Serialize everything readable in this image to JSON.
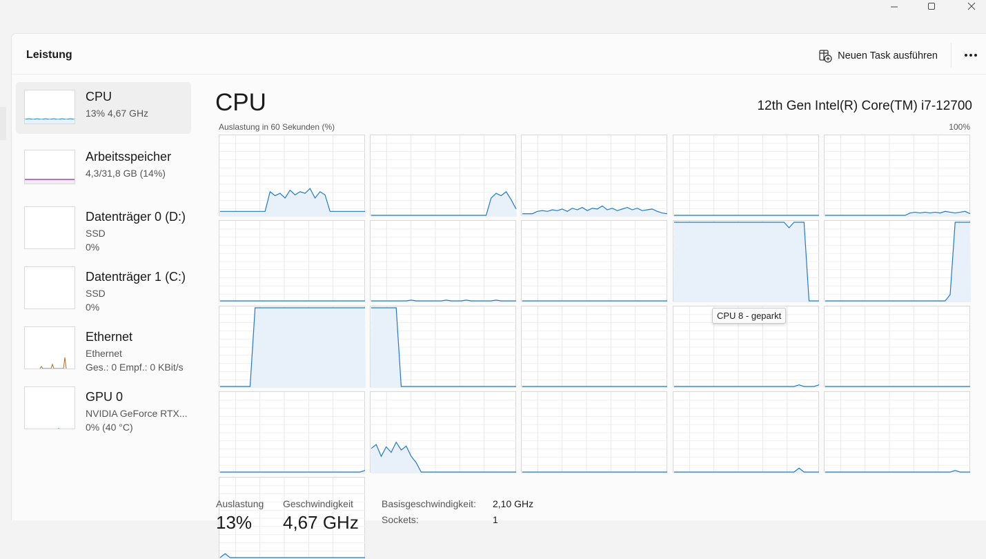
{
  "window": {
    "controls": [
      "minimize-icon",
      "maximize-icon",
      "close-icon"
    ]
  },
  "header": {
    "title": "Leistung",
    "run_task_label": "Neuen Task ausführen",
    "more_icon": "more-icon"
  },
  "sidebar": {
    "items": [
      {
        "name": "CPU",
        "sub1": "13%  4,67 GHz",
        "sub2": "",
        "color": "#1f78c8"
      },
      {
        "name": "Arbeitsspeicher",
        "sub1": "4,3/31,8 GB (14%)",
        "sub2": "",
        "color": "#8b2a9b"
      },
      {
        "name": "Datenträger 0 (D:)",
        "sub1": "SSD",
        "sub2": "0%",
        "color": "#4c9a2a"
      },
      {
        "name": "Datenträger 1 (C:)",
        "sub1": "SSD",
        "sub2": "0%",
        "color": "#4c9a2a"
      },
      {
        "name": "Ethernet",
        "sub1": "Ethernet",
        "sub2": "Ges.: 0  Empf.: 0 KBit/s",
        "color": "#b5651d"
      },
      {
        "name": "GPU 0",
        "sub1": "NVIDIA GeForce RTX...",
        "sub2": "0%  (40 °C)",
        "color": "#1f78c8"
      }
    ]
  },
  "main": {
    "title": "CPU",
    "model": "12th Gen Intel(R) Core(TM) i7-12700",
    "axis_label": "Auslastung in 60 Sekunden (%)",
    "axis_max": "100%",
    "tooltip": "CPU 8 - geparkt"
  },
  "stats": {
    "utilization_label": "Auslastung",
    "utilization_value": "13%",
    "speed_label": "Geschwindigkeit",
    "speed_value": "4,67 GHz",
    "base_speed_label": "Basisgeschwindigkeit:",
    "base_speed_value": "2,10 GHz",
    "sockets_label": "Sockets:",
    "sockets_value": "1"
  },
  "chart_data": {
    "type": "line",
    "title": "Auslastung in 60 Sekunden (%)",
    "ylim": [
      0,
      100
    ],
    "x_points": 30,
    "series": [
      {
        "values": [
          5,
          5,
          5,
          5,
          5,
          5,
          5,
          5,
          5,
          5,
          30,
          25,
          28,
          22,
          32,
          26,
          30,
          28,
          34,
          22,
          30,
          26,
          5,
          5,
          5,
          5,
          5,
          5,
          5,
          5
        ]
      },
      {
        "values": [
          0,
          0,
          0,
          0,
          0,
          0,
          0,
          0,
          0,
          0,
          0,
          0,
          0,
          0,
          0,
          0,
          0,
          0,
          0,
          0,
          0,
          0,
          0,
          0,
          22,
          28,
          25,
          30,
          20,
          8
        ]
      },
      {
        "values": [
          2,
          2,
          2,
          5,
          6,
          5,
          7,
          6,
          8,
          5,
          9,
          7,
          10,
          6,
          9,
          8,
          12,
          7,
          9,
          6,
          8,
          10,
          7,
          9,
          6,
          7,
          8,
          5,
          3,
          2
        ]
      },
      {
        "values": [
          0,
          0,
          0,
          0,
          0,
          0,
          0,
          0,
          0,
          0,
          0,
          0,
          0,
          0,
          0,
          0,
          0,
          0,
          0,
          0,
          0,
          0,
          0,
          0,
          0,
          0,
          0,
          0,
          0,
          0
        ]
      },
      {
        "values": [
          0,
          0,
          0,
          0,
          0,
          0,
          0,
          0,
          0,
          0,
          0,
          0,
          0,
          0,
          0,
          0,
          0,
          3,
          4,
          3,
          4,
          3,
          4,
          3,
          5,
          4,
          3,
          4,
          5,
          2
        ]
      },
      {
        "values": [
          0,
          0,
          0,
          0,
          0,
          0,
          0,
          0,
          0,
          0,
          0,
          0,
          0,
          0,
          0,
          0,
          0,
          0,
          0,
          0,
          0,
          0,
          0,
          0,
          0,
          0,
          0,
          0,
          0,
          0
        ]
      },
      {
        "values": [
          0,
          0,
          0,
          0,
          0,
          0,
          0,
          0,
          1,
          0,
          0,
          0,
          0,
          0,
          0,
          1,
          0,
          0,
          0,
          1,
          0,
          0,
          0,
          0,
          0,
          1,
          0,
          0,
          0,
          0
        ]
      },
      {
        "values": [
          0,
          0,
          0,
          0,
          0,
          0,
          0,
          0,
          0,
          0,
          0,
          0,
          0,
          0,
          0,
          0,
          0,
          0,
          0,
          0,
          0,
          0,
          0,
          0,
          0,
          0,
          0,
          0,
          0,
          0
        ]
      },
      {
        "values": [
          100,
          100,
          100,
          100,
          100,
          100,
          100,
          100,
          100,
          100,
          100,
          100,
          100,
          100,
          100,
          100,
          100,
          100,
          100,
          100,
          100,
          100,
          100,
          93,
          100,
          100,
          100,
          0,
          0,
          0
        ]
      },
      {
        "values": [
          0,
          0,
          0,
          0,
          0,
          0,
          0,
          0,
          0,
          0,
          0,
          0,
          0,
          0,
          0,
          0,
          0,
          0,
          0,
          0,
          0,
          0,
          0,
          0,
          0,
          8,
          100,
          100,
          100,
          100
        ]
      },
      {
        "values": [
          0,
          0,
          0,
          0,
          0,
          0,
          0,
          100,
          100,
          100,
          100,
          100,
          100,
          100,
          100,
          100,
          100,
          100,
          100,
          100,
          100,
          100,
          100,
          100,
          100,
          100,
          100,
          100,
          100,
          100
        ]
      },
      {
        "values": [
          100,
          100,
          100,
          100,
          100,
          100,
          0,
          0,
          0,
          0,
          0,
          0,
          0,
          0,
          0,
          0,
          0,
          0,
          0,
          0,
          0,
          0,
          0,
          0,
          0,
          0,
          0,
          0,
          0,
          0
        ]
      },
      {
        "values": [
          0,
          0,
          0,
          0,
          0,
          0,
          0,
          0,
          0,
          0,
          0,
          0,
          0,
          0,
          0,
          0,
          0,
          0,
          0,
          0,
          0,
          0,
          0,
          0,
          0,
          0,
          0,
          0,
          0,
          0
        ]
      },
      {
        "values": [
          0,
          0,
          0,
          0,
          0,
          0,
          0,
          0,
          0,
          0,
          0,
          0,
          0,
          0,
          0,
          0,
          0,
          0,
          0,
          0,
          0,
          0,
          0,
          0,
          0,
          2,
          0,
          0,
          0,
          2
        ]
      },
      {
        "values": [
          0,
          0,
          0,
          0,
          0,
          0,
          0,
          0,
          0,
          0,
          0,
          0,
          0,
          0,
          0,
          0,
          0,
          0,
          0,
          0,
          0,
          0,
          0,
          0,
          0,
          0,
          0,
          0,
          0,
          0
        ]
      },
      {
        "values": [
          0,
          0,
          0,
          0,
          0,
          0,
          0,
          0,
          0,
          0,
          0,
          0,
          0,
          0,
          0,
          0,
          0,
          0,
          0,
          0,
          0,
          0,
          0,
          0,
          0,
          0,
          0,
          0,
          0,
          2
        ]
      },
      {
        "values": [
          30,
          35,
          20,
          32,
          25,
          38,
          28,
          33,
          20,
          12,
          0,
          0,
          0,
          0,
          0,
          0,
          0,
          0,
          0,
          0,
          0,
          0,
          0,
          0,
          0,
          0,
          0,
          0,
          0,
          0
        ]
      },
      {
        "values": [
          0,
          0,
          0,
          0,
          0,
          0,
          0,
          0,
          0,
          0,
          0,
          0,
          0,
          0,
          0,
          0,
          0,
          0,
          0,
          0,
          0,
          0,
          0,
          0,
          0,
          0,
          0,
          0,
          0,
          0
        ]
      },
      {
        "values": [
          0,
          0,
          0,
          0,
          0,
          0,
          0,
          0,
          0,
          0,
          0,
          0,
          0,
          0,
          0,
          0,
          0,
          0,
          0,
          0,
          0,
          0,
          0,
          0,
          0,
          5,
          0,
          0,
          0,
          0
        ]
      },
      {
        "values": [
          0,
          0,
          0,
          0,
          0,
          0,
          0,
          0,
          0,
          0,
          0,
          0,
          0,
          0,
          0,
          0,
          0,
          0,
          0,
          0,
          0,
          0,
          0,
          0,
          0,
          0,
          2,
          0,
          0,
          0
        ]
      },
      {
        "values": [
          0,
          5,
          0,
          0,
          0,
          0,
          0,
          0,
          0,
          0,
          0,
          0,
          0,
          0,
          0,
          0,
          0,
          0,
          0,
          0,
          0,
          0,
          0,
          0,
          0,
          0,
          0,
          0,
          0,
          0
        ]
      }
    ]
  }
}
